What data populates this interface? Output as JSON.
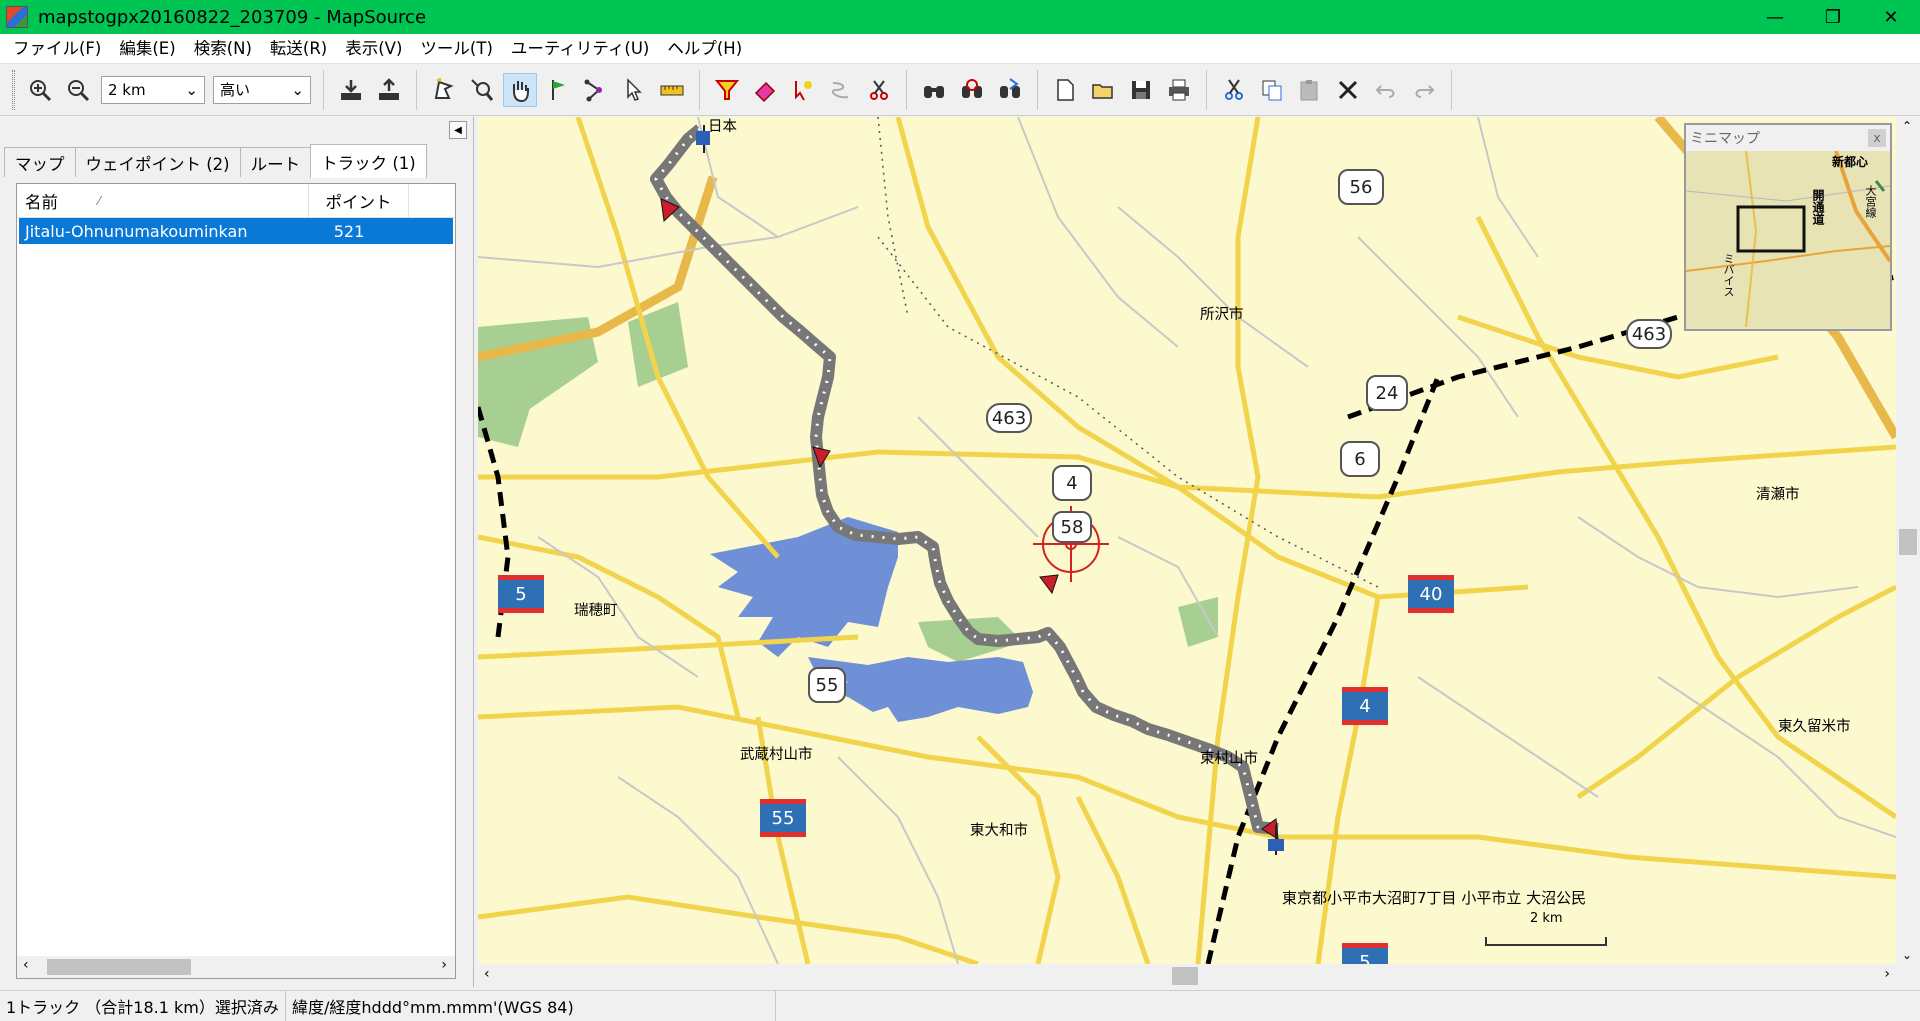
{
  "window": {
    "title": "mapstogpx20160822_203709 - MapSource",
    "min": "—",
    "max": "❐",
    "close": "✕"
  },
  "menu": [
    "ファイル(F)",
    "編集(E)",
    "検索(N)",
    "転送(R)",
    "表示(V)",
    "ツール(T)",
    "ユーティリティ(U)",
    "ヘルプ(H)"
  ],
  "toolbar": {
    "zoom_value": "2 km",
    "detail_value": "高い"
  },
  "tabs": [
    "マップ",
    "ウェイポイント (2)",
    "ルート",
    "トラック (1)"
  ],
  "list": {
    "col_name": "名前",
    "col_sort_mark": "⁄",
    "col_points": "ポイント",
    "rows": [
      {
        "name": "Jitalu-Ohnunumakouminkan",
        "points": "521"
      }
    ]
  },
  "minimap": {
    "title": "ミニマップ",
    "close": "x",
    "labels": [
      "新都心",
      "大宮線",
      "開通道",
      "ミバイス"
    ]
  },
  "map": {
    "places": [
      "日本",
      "所沢市",
      "清瀬市",
      "瑞穂町",
      "武蔵村山市",
      "東村山市",
      "東大和市",
      "東久留米市",
      "東京都小平市大沼町7丁目 小平市立 大沼公民",
      "2 km"
    ],
    "shields": [
      "56",
      "463",
      "463",
      "24",
      "4",
      "6",
      "58",
      "55"
    ],
    "interstates": [
      "5",
      "40",
      "4",
      "55",
      "5"
    ]
  },
  "status": {
    "left": "1トラック （合計18.1 km）選択済み",
    "coords": "緯度/経度hddd°mm.mmm'(WGS 84)"
  },
  "colors": {
    "titlebar": "#00c553",
    "selection": "#0a78d7",
    "map_bg": "#fcf9cf",
    "road": "#f2d44c",
    "water": "#6f8fd6",
    "park": "#a7cf92",
    "track": "#777777"
  }
}
